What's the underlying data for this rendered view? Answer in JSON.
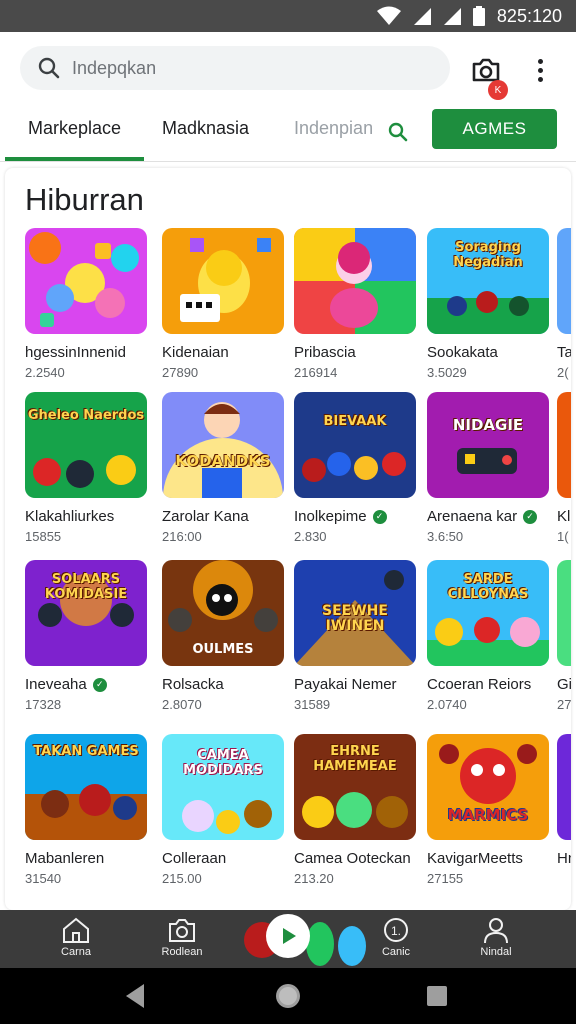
{
  "status": {
    "time": "825:120"
  },
  "search": {
    "placeholder": "Indepqkan"
  },
  "header": {
    "badge": "K"
  },
  "tabs": [
    {
      "label": "Markeplace"
    },
    {
      "label": "Madknasia"
    },
    {
      "label": "Indenpian"
    }
  ],
  "games_button": "AGMES",
  "section": {
    "title": "Hiburran"
  },
  "apps": [
    {
      "name": "hgessinInnenid",
      "size": "2.2540",
      "verified": false
    },
    {
      "name": "Kidenaian",
      "size": "27890",
      "verified": false
    },
    {
      "name": "Pribascia",
      "size": "216914",
      "verified": false
    },
    {
      "name": "Sookakata",
      "size": "3.5029",
      "verified": false
    },
    {
      "name": "Ta",
      "size": "2(",
      "verified": false
    },
    {
      "name": "Klakahliurkes",
      "size": "15855",
      "verified": false
    },
    {
      "name": "Zarolar Kana",
      "size": "216:00",
      "verified": false
    },
    {
      "name": "Inolkepime",
      "size": "2.830",
      "verified": true
    },
    {
      "name": "Arenaena kar",
      "size": "3.6:50",
      "verified": true
    },
    {
      "name": "Kl",
      "size": "1(",
      "verified": false
    },
    {
      "name": "Ineveaha",
      "size": "17328",
      "verified": true
    },
    {
      "name": "Rolsacka",
      "size": "2.8070",
      "verified": false
    },
    {
      "name": "Payakai Nemer",
      "size": "31589",
      "verified": false
    },
    {
      "name": "Ccoeran Reiors",
      "size": "2.0740",
      "verified": false
    },
    {
      "name": "Gia",
      "size": "27",
      "verified": false
    },
    {
      "name": "Mabanleren",
      "size": "31540",
      "verified": false
    },
    {
      "name": "Colleraan",
      "size": "215.00",
      "verified": false
    },
    {
      "name": "Camea Ooteckan",
      "size": "213.20",
      "verified": false
    },
    {
      "name": "KavigarMeetts",
      "size": "27155",
      "verified": false
    },
    {
      "name": "Hn",
      "size": "",
      "verified": true
    }
  ],
  "thumb_titles": {
    "t4": "Soraging Negadian",
    "t6": "Gheleo Naerdos",
    "t7": "KODANDKS",
    "t8": "BIEVAAK",
    "t9": "NIDAGIE",
    "t11": "SOLAARS KOMIDASIE",
    "t12": "OULMES",
    "t13": "SEEWHE IWINEN",
    "t14": "SARDE CILLOYNAS",
    "t16": "TAKAN GAMES",
    "t17": "CAMEA MODIDARS",
    "t18": "EHRNE HAMEMEAE",
    "t19": "MARMICS"
  },
  "bottom_nav": [
    {
      "label": "Carna",
      "icon": "home-icon"
    },
    {
      "label": "Rodlean",
      "icon": "camera-icon"
    },
    {
      "label": "Canic",
      "icon": "info-icon"
    },
    {
      "label": "Nindal",
      "icon": "person-icon"
    }
  ],
  "colors": {
    "accent": "#1e8e3e",
    "status_bar": "#4a4a4a",
    "nav_bar": "#3b3b3b"
  }
}
